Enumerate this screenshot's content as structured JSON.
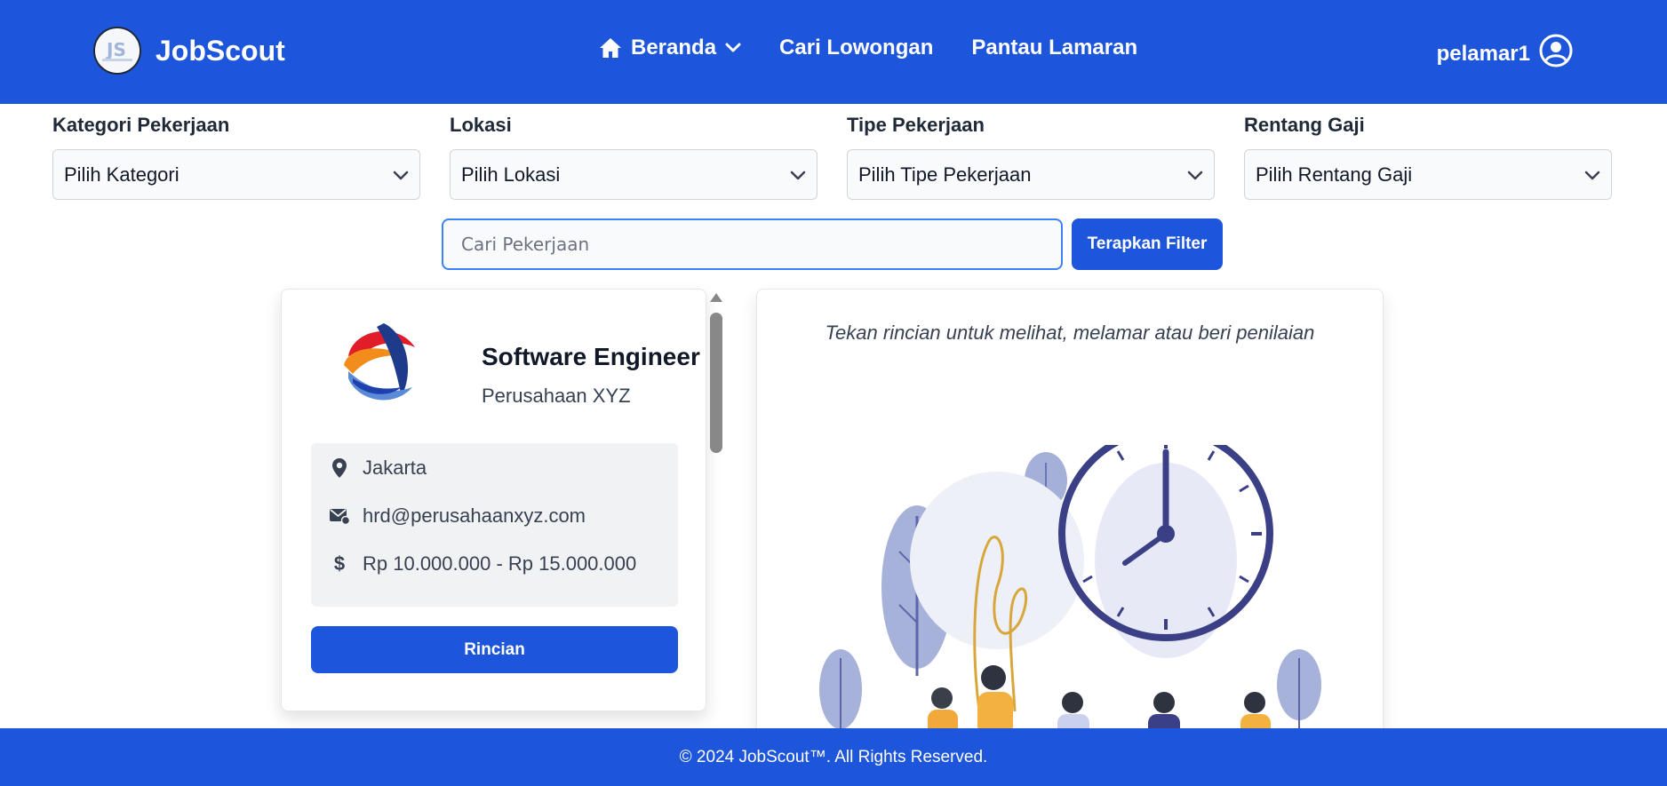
{
  "header": {
    "brand": "JobScout",
    "nav": [
      {
        "label": "Beranda",
        "icon": "home-icon",
        "has_dropdown": true
      },
      {
        "label": "Cari Lowongan"
      },
      {
        "label": "Pantau Lamaran"
      }
    ],
    "username": "pelamar1"
  },
  "filters": [
    {
      "label": "Kategori Pekerjaan",
      "selected": "Pilih Kategori"
    },
    {
      "label": "Lokasi",
      "selected": "Pilih Lokasi"
    },
    {
      "label": "Tipe Pekerjaan",
      "selected": "Pilih Tipe Pekerjaan"
    },
    {
      "label": "Rentang Gaji",
      "selected": "Pilih Rentang Gaji"
    }
  ],
  "search": {
    "placeholder": "Cari Pekerjaan",
    "value": "",
    "apply_label": "Terapkan Filter"
  },
  "job_card": {
    "title": "Software Engineer",
    "company": "Perusahaan XYZ",
    "location": "Jakarta",
    "email": "hrd@perusahaanxyz.com",
    "salary": "Rp 10.000.000 - Rp 15.000.000",
    "detail_label": "Rincian"
  },
  "detail_panel": {
    "hint": "Tekan rincian untuk melihat, melamar atau beri penilaian"
  },
  "footer": {
    "text": "© 2024 JobScout™. All Rights Reserved."
  },
  "colors": {
    "primary": "#1d55db",
    "info_bg": "#f1f2f4"
  }
}
